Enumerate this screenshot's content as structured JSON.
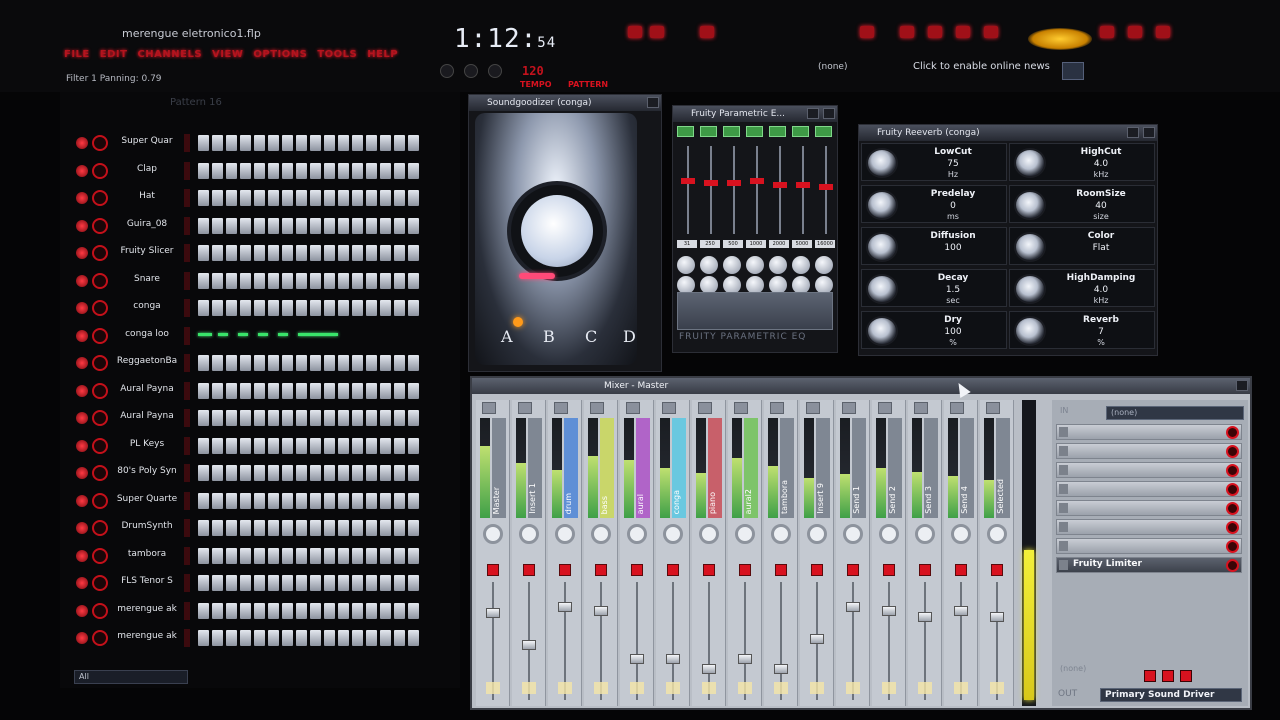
{
  "app": {
    "song_title": "merengue eletronico1.flp",
    "menu": [
      "FILE",
      "EDIT",
      "CHANNELS",
      "VIEW",
      "OPTIONS",
      "TOOLS",
      "HELP"
    ],
    "hint": "Filter 1 Panning: 0.79",
    "time_main": "1:12:",
    "time_sub": "54",
    "tempo_value": "120",
    "tempo_label": "TEMPO",
    "pattern_label": "PATTERN",
    "news": "Click to enable online news",
    "preset_none": "(none)"
  },
  "rack": {
    "pattern_selector": "Pattern 16",
    "filter": "All",
    "channels": [
      {
        "name": "Super Quar"
      },
      {
        "name": "Clap"
      },
      {
        "name": "Hat"
      },
      {
        "name": "Guira_08"
      },
      {
        "name": "Fruity Slicer"
      },
      {
        "name": "Snare"
      },
      {
        "name": "conga"
      },
      {
        "name": "conga loo"
      },
      {
        "name": "ReggaetonBa"
      },
      {
        "name": "Aural Payna"
      },
      {
        "name": "Aural Payna"
      },
      {
        "name": "PL Keys"
      },
      {
        "name": "80's Poly Syn"
      },
      {
        "name": "Super Quarte"
      },
      {
        "name": "DrumSynth"
      },
      {
        "name": "tambora"
      },
      {
        "name": "FLS Tenor S"
      },
      {
        "name": "merengue ak"
      },
      {
        "name": "merengue ak"
      }
    ]
  },
  "soundgoodizer": {
    "title": "Soundgoodizer (conga)",
    "presets": [
      "A",
      "B",
      "C",
      "D"
    ],
    "selected": "A"
  },
  "eq": {
    "title": "Fruity Parametric E...",
    "logo": "FRUITY PARAMETRIC EQ",
    "freqs": [
      "31",
      "250",
      "500",
      "1000",
      "2000",
      "5000",
      "16000"
    ]
  },
  "reverb": {
    "title": "Fruity Reeverb (conga)",
    "params": [
      {
        "name": "LowCut",
        "value": "75",
        "unit": "Hz"
      },
      {
        "name": "HighCut",
        "value": "4.0",
        "unit": "kHz"
      },
      {
        "name": "Predelay",
        "value": "0",
        "unit": "ms"
      },
      {
        "name": "RoomSize",
        "value": "40",
        "unit": "size"
      },
      {
        "name": "Diffusion",
        "value": "100",
        "unit": ""
      },
      {
        "name": "Color",
        "value": "Flat",
        "unit": ""
      },
      {
        "name": "Decay",
        "value": "1.5",
        "unit": "sec"
      },
      {
        "name": "HighDamping",
        "value": "4.0",
        "unit": "kHz"
      },
      {
        "name": "Dry",
        "value": "100",
        "unit": "%"
      },
      {
        "name": "Reverb",
        "value": "7",
        "unit": "%"
      }
    ]
  },
  "mixer": {
    "title": "Mixer - Master",
    "tracks": [
      {
        "name": "Master",
        "color": "#7f8793",
        "level": 0.72
      },
      {
        "name": "Insert 1",
        "color": "#7f8793",
        "level": 0.55
      },
      {
        "name": "drum",
        "color": "#5f8fd6",
        "level": 0.48
      },
      {
        "name": "bass",
        "color": "#c9d66a",
        "level": 0.62
      },
      {
        "name": "aural",
        "color": "#b064c8",
        "level": 0.58
      },
      {
        "name": "conga",
        "color": "#6ac8e0",
        "level": 0.5
      },
      {
        "name": "piano",
        "color": "#c8606a",
        "level": 0.45
      },
      {
        "name": "aural2",
        "color": "#7ec46a",
        "level": 0.6
      },
      {
        "name": "tambora",
        "color": "#7f8793",
        "level": 0.52
      },
      {
        "name": "Insert 9",
        "color": "#7f8793",
        "level": 0.4
      },
      {
        "name": "Send 1",
        "color": "#7f8793",
        "level": 0.44
      },
      {
        "name": "Send 2",
        "color": "#7f8793",
        "level": 0.5
      },
      {
        "name": "Send 3",
        "color": "#7f8793",
        "level": 0.46
      },
      {
        "name": "Send 4",
        "color": "#7f8793",
        "level": 0.42
      },
      {
        "name": "Selected",
        "color": "#7f8793",
        "level": 0.38
      }
    ],
    "fx_input": "(none)",
    "fx_input_label": "IN",
    "fx_slot_active": "Fruity Limiter",
    "output_label": "OUT",
    "output": "Primary Sound Driver",
    "none_label": "(none)"
  }
}
